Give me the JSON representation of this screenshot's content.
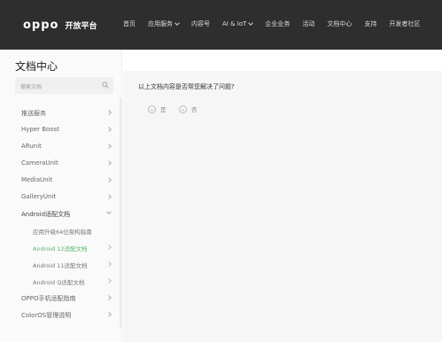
{
  "header": {
    "logo_text": "oppo",
    "logo_sub": "开放平台",
    "nav": [
      {
        "label": "首页",
        "dropdown": false
      },
      {
        "label": "应用服务",
        "dropdown": true
      },
      {
        "label": "内容号",
        "dropdown": false
      },
      {
        "label": "AI & IoT",
        "dropdown": true
      },
      {
        "label": "企业业务",
        "dropdown": false
      },
      {
        "label": "活动",
        "dropdown": false
      },
      {
        "label": "文档中心",
        "dropdown": false
      },
      {
        "label": "支持",
        "dropdown": false
      },
      {
        "label": "开发者社区",
        "dropdown": false
      }
    ]
  },
  "sidebar": {
    "title": "文档中心",
    "search_placeholder": "搜索文档",
    "items": [
      {
        "label": "推送服务"
      },
      {
        "label": "Hyper Boost"
      },
      {
        "label": "ARunit"
      },
      {
        "label": "CameraUnit"
      },
      {
        "label": "MediaUnit"
      },
      {
        "label": "GalleryUnit"
      },
      {
        "label": "Android适配文档"
      },
      {
        "label": "应用升级64位架构指南"
      },
      {
        "label": "Android 12适配文档"
      },
      {
        "label": "Android 11适配文档"
      },
      {
        "label": "Android Q适配文档"
      },
      {
        "label": "OPPO手机适配指南"
      },
      {
        "label": "ColorOS管理说明"
      }
    ]
  },
  "main": {
    "question": "以上文档内容是否帮您解决了问题?",
    "yes_label": "是",
    "no_label": "否"
  },
  "colors": {
    "header_bg": "#2e2e2e",
    "accent": "#58b46c"
  }
}
